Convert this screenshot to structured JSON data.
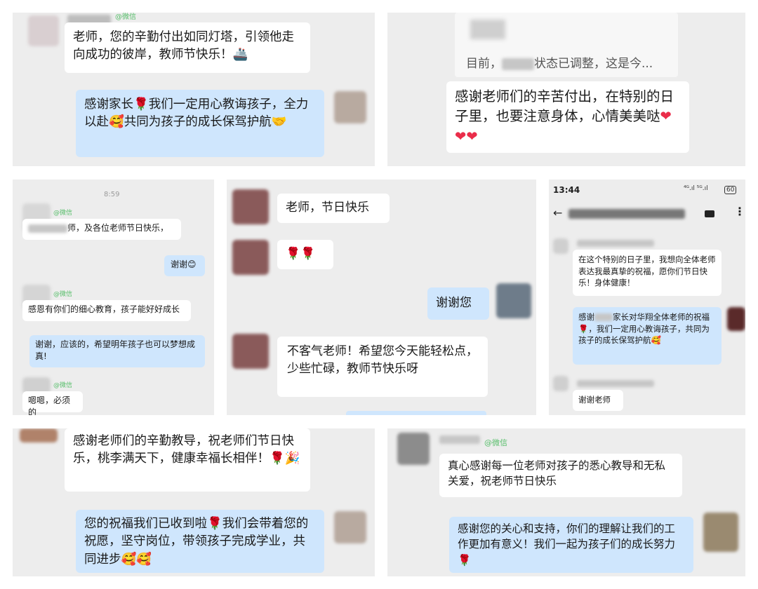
{
  "p1": {
    "wechat_tag": "@微信",
    "msg1": "老师，您的辛勤付出如同灯塔，引领他走向成功的彼岸，教师节快乐！🚢",
    "msg2_a": "感谢家长",
    "msg2_b": "我们一定用心教诲孩子，全力以赴🥰共同为孩子的成长保驾护航🤝"
  },
  "p2": {
    "quote_a": "目前，",
    "quote_b": "状态已调整，这是今...",
    "msg": "感谢老师们的辛苦付出，在特别的日子里，也要注意身体，心情美美哒",
    "hearts": "❤❤❤"
  },
  "p3": {
    "time": "8:59",
    "wechat_tag": "@微信",
    "msg1_suffix": "师，及各位老师节日快乐，",
    "reply1": "谢谢😊",
    "msg2": "感恩有你们的细心教育，孩子能好好成长",
    "reply2": "谢谢，应该的，希望明年孩子也可以梦想成真!",
    "msg3": "嗯嗯，必须的"
  },
  "p4": {
    "msg1": "老师，节日快乐",
    "msg2": "🌹🌹",
    "reply": "谢谢您",
    "msg3": "不客气老师！希望您今天能轻松点，少些忙碌，教师节快乐呀"
  },
  "p5": {
    "status_time": "13:44",
    "status_icons": "⁴ᴳ.ıl ⁵ᴳ.ıl",
    "battery": "60",
    "msg1": "在这个特别的日子里，我想向全体老师表达我最真挚的祝福，愿你们节日快乐！身体健康！",
    "reply_a": "感谢",
    "reply_b": "家长对华翔全体老师的祝福🌹，我们一定用心教诲孩子，共同为孩子的成长保驾护航🥰",
    "msg2": "谢谢老师"
  },
  "p6": {
    "msg": "感谢老师们的辛勤教导，祝老师们节日快乐，桃李满天下，健康幸福长相伴！🌹🎉",
    "reply": "您的祝福我们已收到啦🌹我们会带着您的祝愿，坚守岗位，带领孩子完成学业，共同进步🥰🥰"
  },
  "p7": {
    "wechat_tag": "@微信",
    "msg": "真心感谢每一位老师对孩子的悉心教导和无私关爱，祝老师节日快乐",
    "reply": "感谢您的关心和支持，你们的理解让我们的工作更加有意义！我们一起为孩子们的成长努力🌹"
  }
}
